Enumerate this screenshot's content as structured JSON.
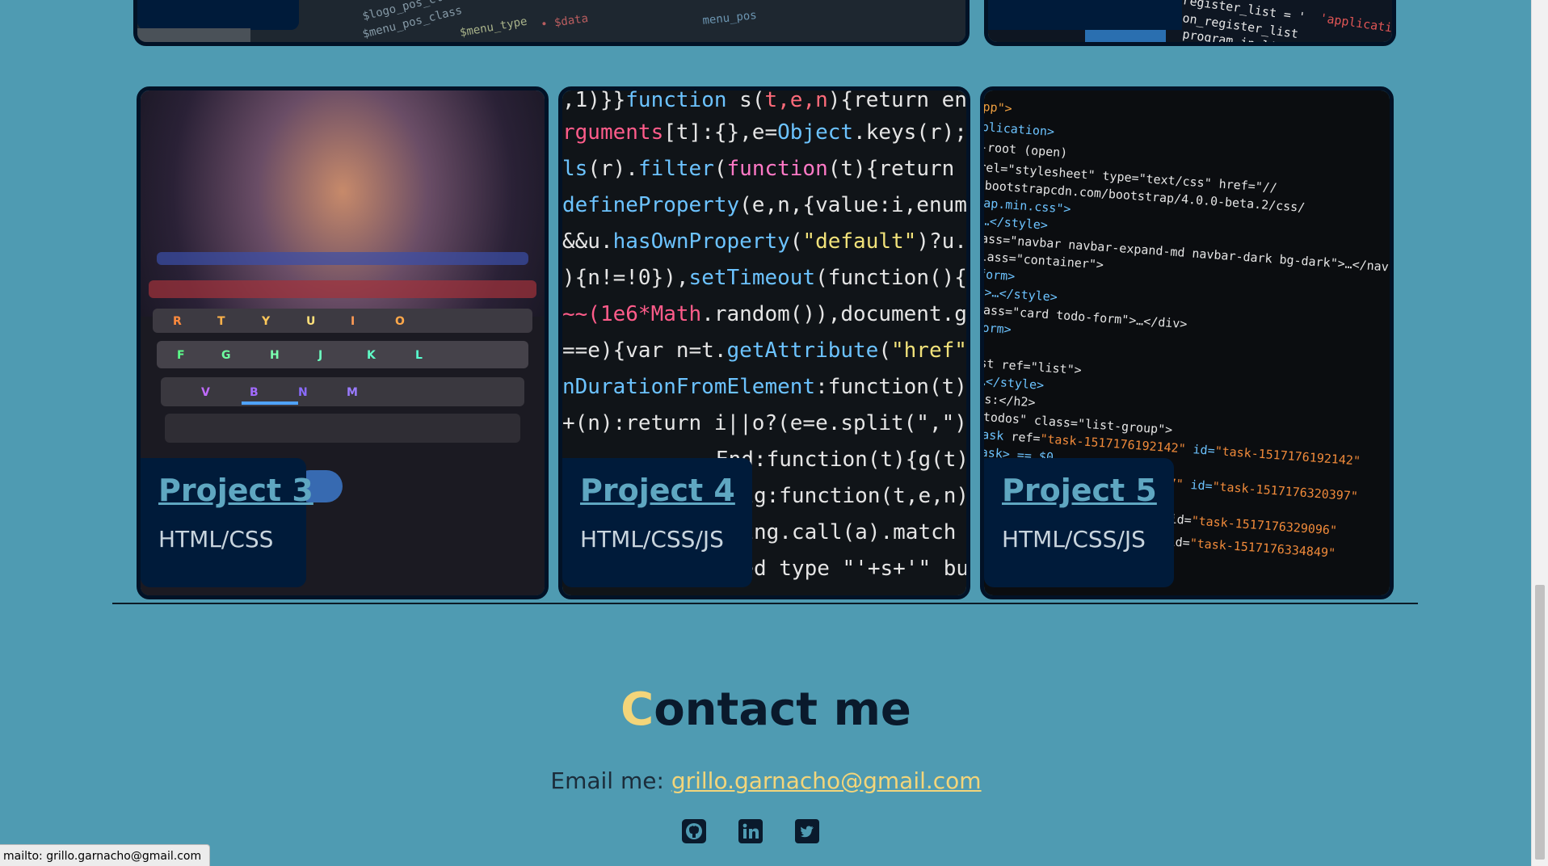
{
  "projects": [
    {
      "title": "Project 3",
      "tech": "HTML/CSS"
    },
    {
      "title": "Project 4",
      "tech": "HTML/CSS/JS"
    },
    {
      "title": "Project 5",
      "tech": "HTML/CSS/JS"
    }
  ],
  "contact": {
    "title_first": "C",
    "title_rest": "ontact me",
    "email_prefix": "Email me: ",
    "email": "grillo.garnacho@gmail.com"
  },
  "socials": [
    {
      "icon": "github-icon"
    },
    {
      "icon": "linkedin-icon"
    },
    {
      "icon": "twitter-icon"
    }
  ],
  "status_bar": {
    "text": "mailto: grillo.garnacho@gmail.com"
  },
  "colors": {
    "background": "#4f9bb2",
    "accent": "#f3d57a",
    "card_border": "#021226",
    "caption_bg": "#001b3a"
  }
}
